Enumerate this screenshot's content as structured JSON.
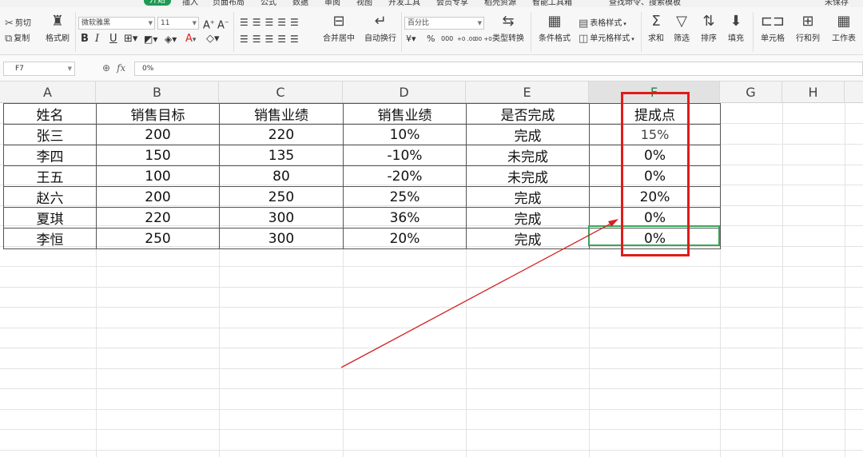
{
  "menu": {
    "items": [
      "开始",
      "插入",
      "页面布局",
      "公式",
      "数据",
      "审阅",
      "视图",
      "开发工具",
      "会员专享",
      "稻壳资源",
      "智能工具箱"
    ],
    "active_index": 0,
    "search_text": "查找命令、搜索模板",
    "right_text": "未保存"
  },
  "ribbon": {
    "cut": "剪切",
    "copy": "复制",
    "format_painter": "格式刷",
    "font_name": "微软雅黑",
    "font_size": "11",
    "merge_center": "合并居中",
    "wrap_text": "自动换行",
    "number_format": "百分比",
    "type_convert": "类型转换",
    "conditional_format": "条件格式",
    "table_style": "表格样式",
    "cell_style": "单元格样式",
    "sum": "求和",
    "filter": "筛选",
    "sort": "排序",
    "fill": "填充",
    "cell": "单元格",
    "row_col": "行和列",
    "worksheet": "工作表",
    "currency": "¥",
    "percent": "%",
    "thousands": "000",
    "inc_dec": "+0 .00",
    "dec_dec": ".00 +0"
  },
  "formula_bar": {
    "cell_ref": "F7",
    "fx": "fx",
    "content": "0%"
  },
  "columns": [
    "A",
    "B",
    "C",
    "D",
    "E",
    "F",
    "G",
    "H"
  ],
  "selected_column": "F",
  "table": {
    "headers": [
      "姓名",
      "销售目标",
      "销售业绩",
      "销售业绩",
      "是否完成",
      "提成点"
    ],
    "rows": [
      [
        "张三",
        "200",
        "220",
        "10%",
        "完成",
        "15%"
      ],
      [
        "李四",
        "150",
        "135",
        "-10%",
        "未完成",
        "0%"
      ],
      [
        "王五",
        "100",
        "80",
        "-20%",
        "未完成",
        "0%"
      ],
      [
        "赵六",
        "200",
        "250",
        "25%",
        "完成",
        "20%"
      ],
      [
        "夏琪",
        "220",
        "300",
        "36%",
        "完成",
        "0%"
      ],
      [
        "李恒",
        "250",
        "300",
        "20%",
        "完成",
        "0%"
      ]
    ]
  },
  "colors": {
    "accent_green": "#1e9b52",
    "highlight_red": "#e01b1b",
    "active_cell_border": "#3aa55a"
  },
  "icons": [
    "cut-icon",
    "copy-icon",
    "format-painter-icon",
    "bold-icon",
    "italic-icon",
    "underline-icon",
    "border-icon",
    "fill-color-icon",
    "font-color-icon",
    "clear-icon",
    "align-icons",
    "merge-icon",
    "wrap-icon",
    "convert-icon",
    "conditional-format-icon",
    "table-style-icon",
    "sum-icon",
    "filter-icon",
    "sort-icon",
    "fill-icon",
    "cell-icon",
    "row-col-icon",
    "worksheet-icon",
    "zoom-icon",
    "fx-icon"
  ]
}
